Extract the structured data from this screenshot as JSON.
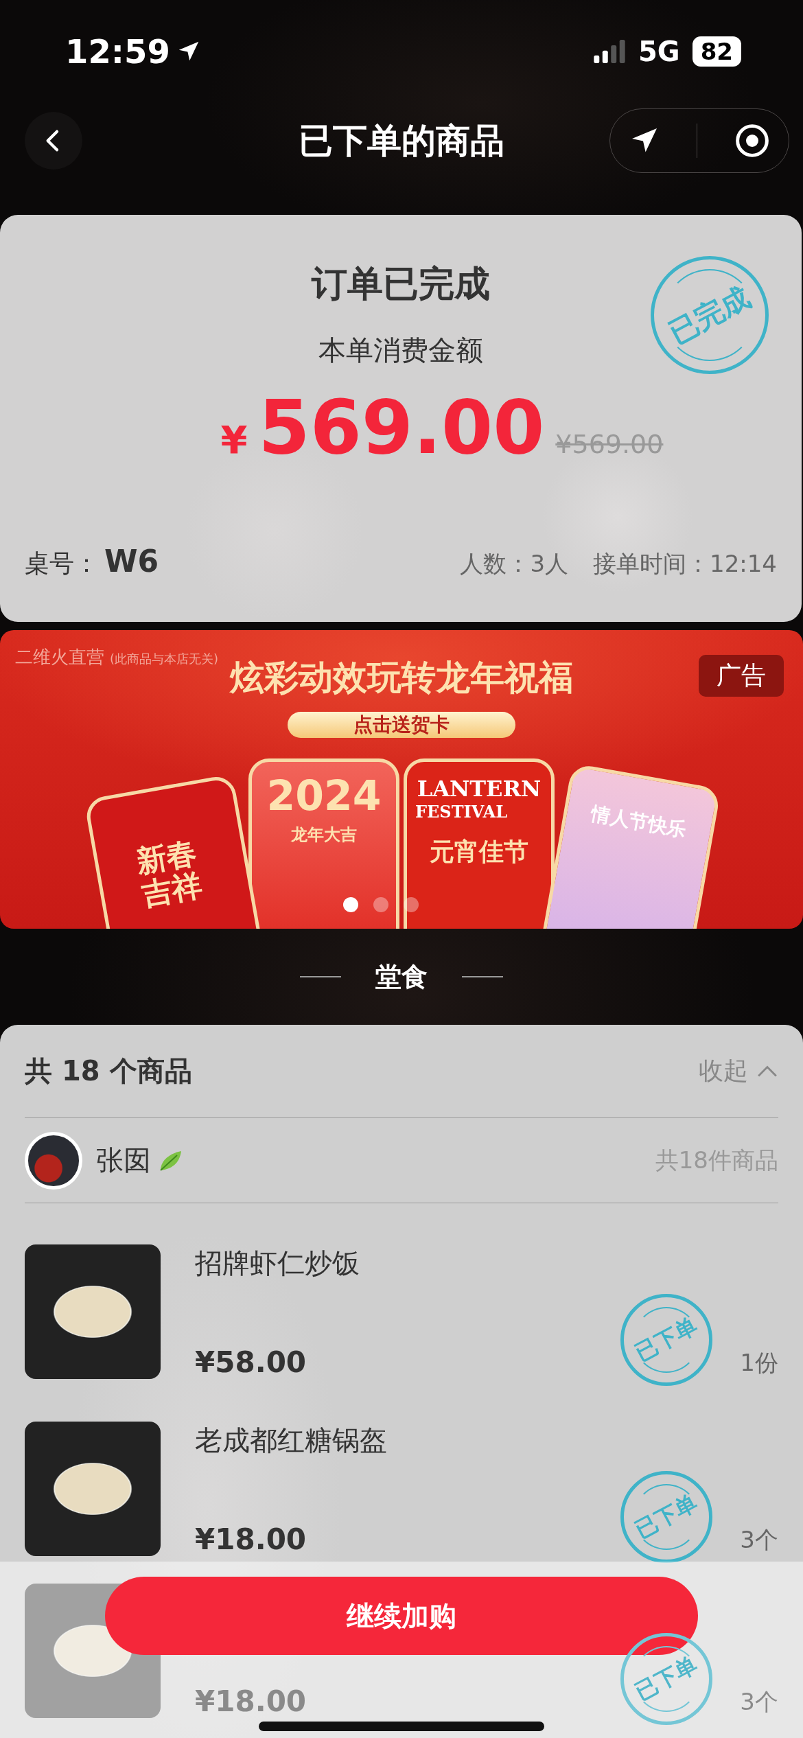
{
  "status_bar": {
    "time": "12:59",
    "network": "5G",
    "battery": "82"
  },
  "nav": {
    "title": "已下单的商品"
  },
  "order": {
    "status_title": "订单已完成",
    "stamp": "已完成",
    "amount_label": "本单消费金额",
    "currency": "¥",
    "amount": "569.00",
    "original_price": "¥569.00",
    "table_label": "桌号：",
    "table_no": "W6",
    "guests_label": "人数：",
    "guests": "3人",
    "time_label": "接单时间：",
    "time": "12:14"
  },
  "banner": {
    "brand": "二维火直营",
    "disclaimer": "(此商品与本店无关)",
    "headline": "炫彩动效玩转龙年祝福",
    "cta": "点击送贺卡",
    "ad_tag": "广告",
    "cards": [
      {
        "kind": "spring",
        "texts": [
          "新春吉祥"
        ]
      },
      {
        "kind": "year",
        "texts": [
          "2024",
          "龙年大吉"
        ]
      },
      {
        "kind": "lantern",
        "texts": [
          "LANTERN",
          "FESTIVAL",
          "元宵佳节"
        ]
      },
      {
        "kind": "valentine",
        "texts": [
          "情人节快乐"
        ]
      }
    ],
    "dots": [
      {
        "selected": true
      },
      {
        "selected": false
      },
      {
        "selected": false
      }
    ]
  },
  "section_title": "堂食",
  "list": {
    "summary": "共 18 个商品",
    "collapse": "收起",
    "shop": {
      "name": "张囡",
      "count": "共18件商品"
    },
    "items": [
      {
        "name": "招牌虾仁炒饭",
        "price": "¥58.00",
        "stamp": "已下单",
        "qty": "1份"
      },
      {
        "name": "老成都红糖锅盔",
        "price": "¥18.00",
        "stamp": "已下单",
        "qty": "3个"
      },
      {
        "price": "¥18.00",
        "stamp": "已下单",
        "qty": "3个"
      }
    ]
  },
  "bottom": {
    "button": "继续加购"
  }
}
